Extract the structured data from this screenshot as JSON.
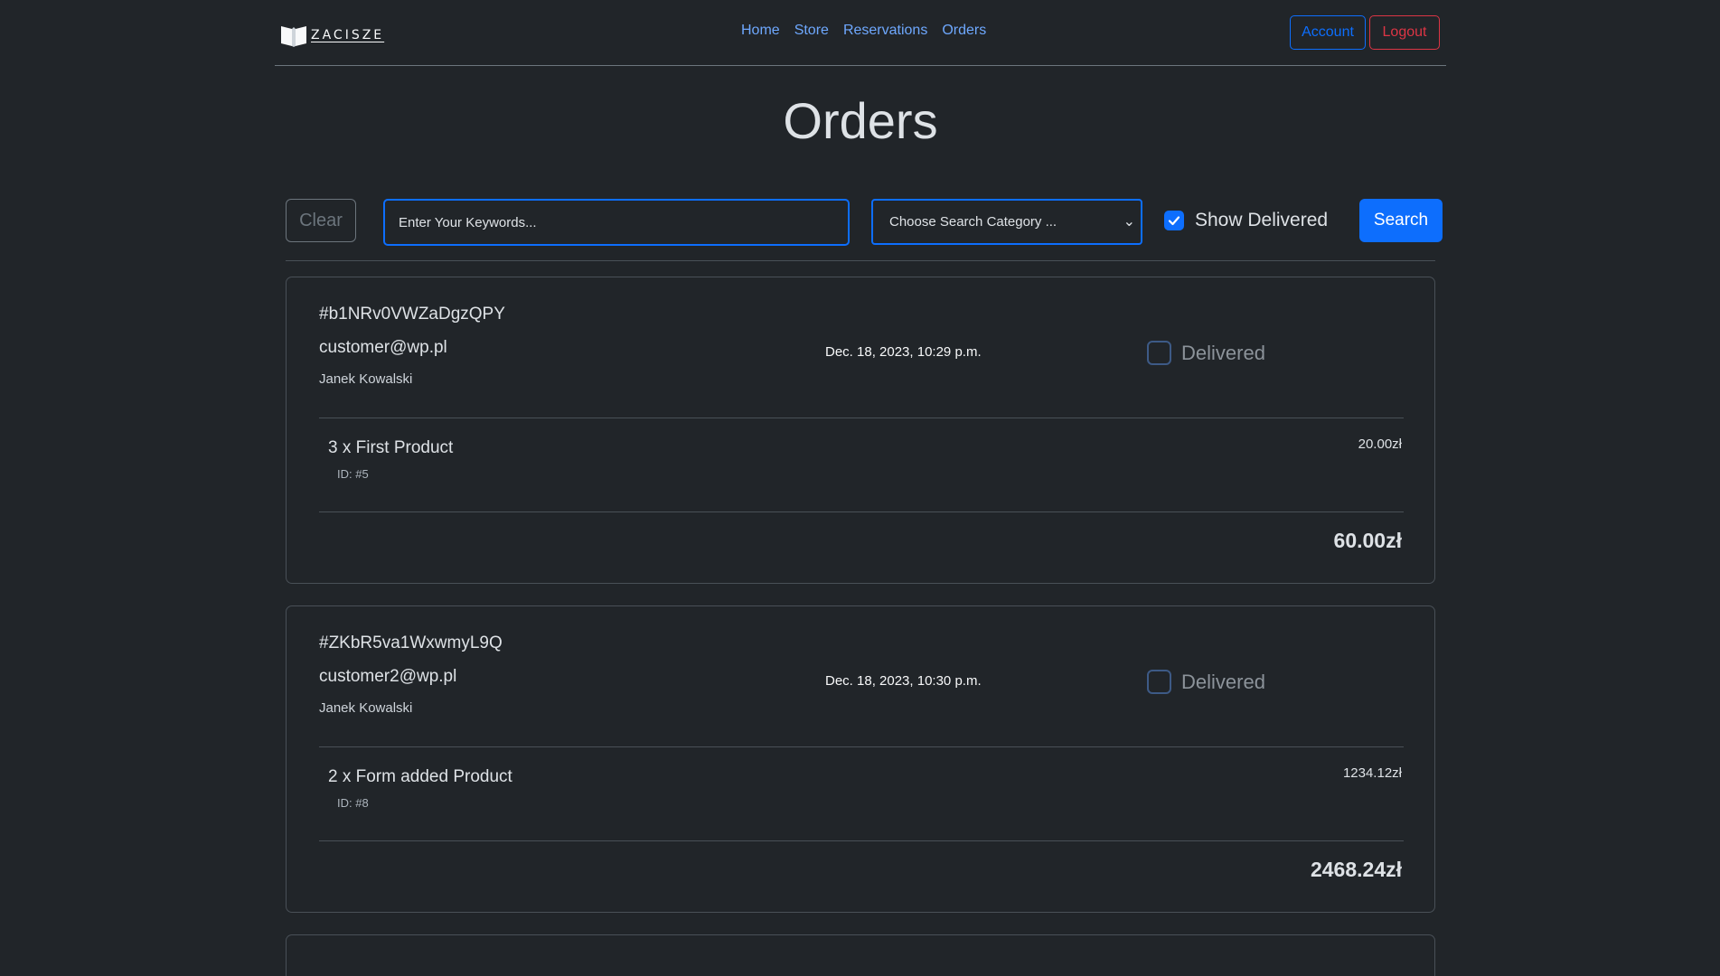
{
  "brand": {
    "name": "ZACISZE",
    "icon": "book-icon"
  },
  "nav": {
    "items": [
      "Home",
      "Store",
      "Reservations",
      "Orders"
    ]
  },
  "header_buttons": {
    "account": "Account",
    "logout": "Logout"
  },
  "page": {
    "title": "Orders"
  },
  "search": {
    "clear_label": "Clear",
    "placeholder": "Enter Your Keywords...",
    "category_selected": "Choose Search Category ...",
    "show_delivered_label": "Show Delivered",
    "show_delivered_checked": true,
    "submit_label": "Search"
  },
  "colors": {
    "background": "#212529",
    "primary": "#0d6efd",
    "danger": "#dc3545",
    "link": "#6ea8fe"
  },
  "orders": [
    {
      "id": "#b1NRv0VWZaDgzQPY",
      "email": "customer@wp.pl",
      "name": "Janek Kowalski",
      "date": "Dec. 18, 2023, 10:29 p.m.",
      "delivered_label": "Delivered",
      "delivered": false,
      "items": [
        {
          "title": "3 x First Product",
          "id_text": "ID: #5",
          "price": "20.00zł"
        }
      ],
      "total": "60.00zł"
    },
    {
      "id": "#ZKbR5va1WxwmyL9Q",
      "email": "customer2@wp.pl",
      "name": "Janek Kowalski",
      "date": "Dec. 18, 2023, 10:30 p.m.",
      "delivered_label": "Delivered",
      "delivered": false,
      "items": [
        {
          "title": "2 x Form added Product",
          "id_text": "ID: #8",
          "price": "1234.12zł"
        }
      ],
      "total": "2468.24zł"
    }
  ]
}
